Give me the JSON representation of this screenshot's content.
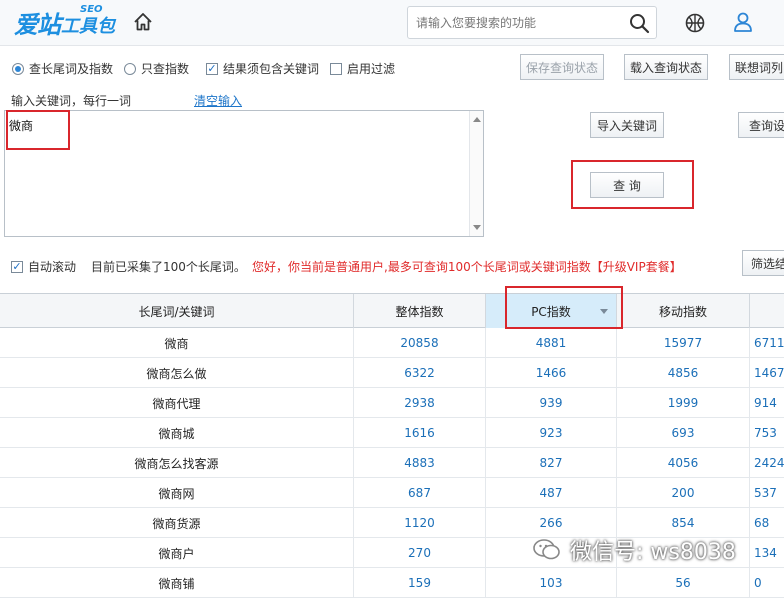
{
  "header": {
    "logo_main": "爱站",
    "logo_sub": "工具包",
    "logo_seo": "SEO",
    "search_placeholder": "请输入您要搜索的功能",
    "icons": [
      "home-icon",
      "search-icon",
      "basketball-icon",
      "user-icon"
    ]
  },
  "options": {
    "mode_longtail": "查长尾词及指数",
    "mode_index_only": "只查指数",
    "must_contain": "结果须包含关键词",
    "enable_filter": "启用过滤",
    "selected_mode": "查长尾词及指数",
    "must_contain_checked": true,
    "enable_filter_checked": false
  },
  "toolbar": {
    "save_state": "保存查询状态",
    "load_state": "载入查询状态",
    "suggest_list": "联想词列"
  },
  "input": {
    "label": "输入关键词，每行一词",
    "clear_link": "清空输入",
    "value": "微商",
    "import_button": "导入关键词",
    "query_settings": "查询设",
    "query_button": "查 询"
  },
  "status": {
    "auto_scroll": "自动滚动",
    "auto_scroll_checked": true,
    "collected": "目前已采集了100个长尾词。",
    "warning": "您好，你当前是普通用户,最多可查询100个长尾词或关键词指数【升级VIP套餐】",
    "filter_button": "筛选结"
  },
  "table": {
    "columns": [
      "长尾词/关键词",
      "整体指数",
      "PC指数",
      "移动指数",
      ""
    ],
    "sorted_column": "PC指数",
    "rows": [
      [
        "微商",
        "20858",
        "4881",
        "15977",
        "6711"
      ],
      [
        "微商怎么做",
        "6322",
        "1466",
        "4856",
        "1467"
      ],
      [
        "微商代理",
        "2938",
        "939",
        "1999",
        "914"
      ],
      [
        "微商城",
        "1616",
        "923",
        "693",
        "753"
      ],
      [
        "微商怎么找客源",
        "4883",
        "827",
        "4056",
        "2424"
      ],
      [
        "微商网",
        "687",
        "487",
        "200",
        "537"
      ],
      [
        "微商货源",
        "1120",
        "266",
        "854",
        "68"
      ],
      [
        "微商户",
        "270",
        "",
        "",
        "134"
      ],
      [
        "微商铺",
        "159",
        "103",
        "56",
        "0"
      ]
    ]
  },
  "watermark": {
    "text": "微信号: ws8038"
  },
  "colors": {
    "brand_blue": "#1d8fe0",
    "highlight_red": "#d9262c",
    "link_blue": "#1d75c9",
    "number_blue": "#1b6fb8",
    "warning_red": "#e02b2b",
    "sorted_header_bg": "#d6ecfa"
  }
}
